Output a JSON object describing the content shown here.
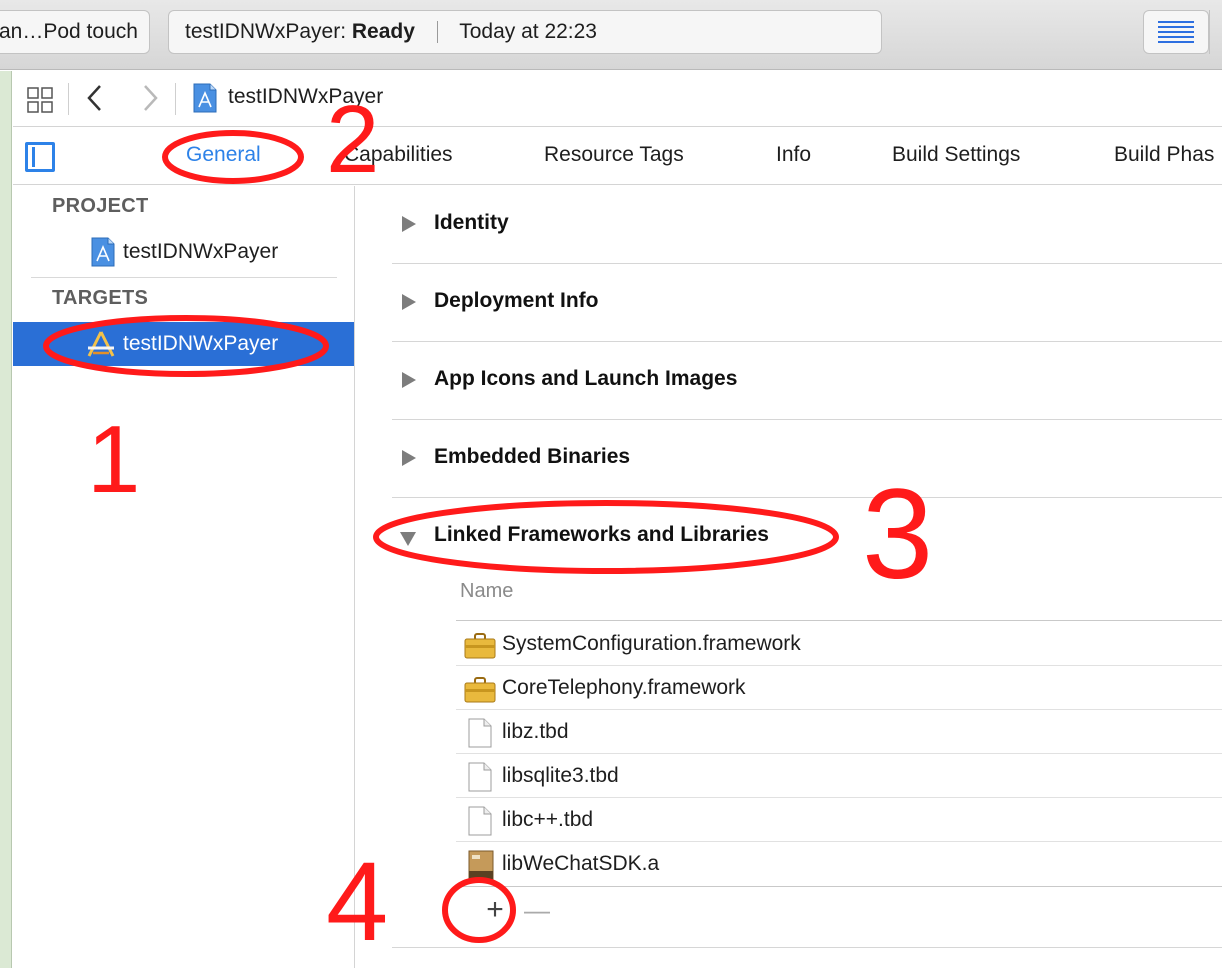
{
  "toolbar": {
    "scheme_device": "an…Pod touch",
    "status_target": "testIDNWxPayer:",
    "status_state": "Ready",
    "status_time": "Today at 22:23"
  },
  "jumpbar": {
    "breadcrumb": "testIDNWxPayer"
  },
  "tabs": [
    {
      "label": "General",
      "active": true
    },
    {
      "label": "Capabilities"
    },
    {
      "label": "Resource Tags"
    },
    {
      "label": "Info"
    },
    {
      "label": "Build Settings"
    },
    {
      "label": "Build Phas"
    }
  ],
  "sidebar": {
    "project_header": "PROJECT",
    "project_item": "testIDNWxPayer",
    "targets_header": "TARGETS",
    "target_item": "testIDNWxPayer"
  },
  "sections": [
    {
      "title": "Identity",
      "expanded": false
    },
    {
      "title": "Deployment Info",
      "expanded": false
    },
    {
      "title": "App Icons and Launch Images",
      "expanded": false
    },
    {
      "title": "Embedded Binaries",
      "expanded": false
    },
    {
      "title": "Linked Frameworks and Libraries",
      "expanded": true
    }
  ],
  "libraries": {
    "column_header": "Name",
    "rows": [
      {
        "name": "SystemConfiguration.framework",
        "icon": "framework-toolbox-icon"
      },
      {
        "name": "CoreTelephony.framework",
        "icon": "framework-toolbox-icon"
      },
      {
        "name": "libz.tbd",
        "icon": "document-icon"
      },
      {
        "name": "libsqlite3.tbd",
        "icon": "document-icon"
      },
      {
        "name": "libc++.tbd",
        "icon": "document-icon"
      },
      {
        "name": "libWeChatSDK.a",
        "icon": "archive-icon"
      }
    ],
    "add_label": "+",
    "remove_label": "—"
  },
  "annotations": {
    "step1": "1",
    "step2": "2",
    "step3": "3",
    "step4": "4",
    "color": "#ff1a1a"
  },
  "colors": {
    "accent": "#2d82e8",
    "selection": "#2a6fd6"
  }
}
